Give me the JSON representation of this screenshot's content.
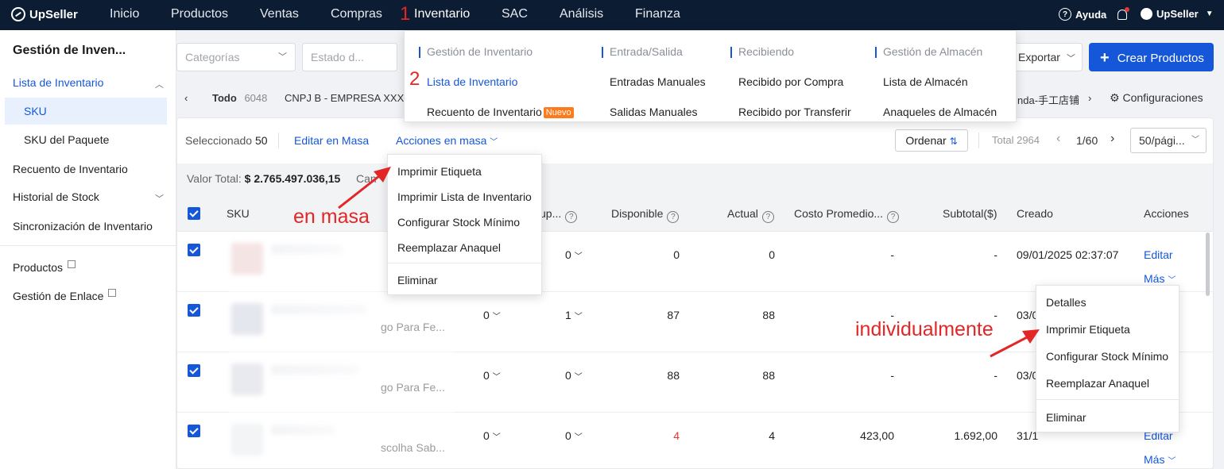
{
  "topnav": {
    "logo": "UpSeller",
    "items": [
      "Inicio",
      "Productos",
      "Ventas",
      "Compras",
      "Inventario",
      "SAC",
      "Análisis",
      "Finanza"
    ],
    "help": "Ayuda",
    "user": "UpSeller"
  },
  "sidebar": {
    "title": "Gestión de Inven...",
    "lista": "Lista de Inventario",
    "sku": "SKU",
    "sku_paquete": "SKU del Paquete",
    "recuento": "Recuento de Inventario",
    "historial": "Historial de Stock",
    "sincronizacion": "Sincronización de Inventario",
    "productos": "Productos",
    "enlace": "Gestión de Enlace"
  },
  "filters": {
    "categorias": "Categorías",
    "estado": "Estado d...",
    "exportar": "Exportar",
    "crear": "Crear Productos"
  },
  "stores": {
    "todo": "Todo",
    "todo_count": "6048",
    "store1": "CNPJ B - EMPRESA XXX",
    "store_last": "nda-手工店铺",
    "config": "Configuraciones"
  },
  "toolbar": {
    "seleccionado": "Seleccionado",
    "seleccionado_count": "50",
    "editar_masa": "Editar en Masa",
    "acciones_masa": "Acciones en masa",
    "ordenar": "Ordenar",
    "total_label": "Total",
    "total": "2964",
    "page": "1/60",
    "perpage": "50/pági..."
  },
  "totalbar": {
    "label": "Valor Total:",
    "value": "$ 2.765.497.036,15",
    "cant": "Can"
  },
  "table": {
    "headers": {
      "sku": "SKU",
      "up": "up...",
      "disponible": "Disponible",
      "actual": "Actual",
      "costo": "Costo Promedio...",
      "subtotal": "Subtotal($)",
      "creado": "Creado",
      "acciones": "Acciones"
    },
    "rows": [
      {
        "name": "",
        "c1": "",
        "c2": "0",
        "disponible": "0",
        "actual": "0",
        "costo": "-",
        "subtotal": "-",
        "creado": "09/01/2025 02:37:07",
        "editar": "Editar",
        "mas": "Más"
      },
      {
        "name": "go Para Fe...",
        "c1": "0",
        "c2": "1",
        "disponible": "87",
        "actual": "88",
        "costo": "-",
        "subtotal": "-",
        "creado": "03/0"
      },
      {
        "name": "go Para Fe...",
        "c1": "0",
        "c2": "0",
        "disponible": "88",
        "actual": "88",
        "costo": "-",
        "subtotal": "-",
        "creado": "03/0"
      },
      {
        "name": "scolha Sab...",
        "c1": "0",
        "c2": "0",
        "disponible": "4",
        "actual": "4",
        "costo": "423,00",
        "subtotal": "1.692,00",
        "creado": "31/1",
        "editar": "Editar",
        "mas": "Más"
      }
    ]
  },
  "mega_menu": {
    "columns": [
      {
        "header": "Gestión de Inventario",
        "items": [
          "Lista de Inventario",
          "Recuento de Inventario"
        ]
      },
      {
        "header": "Entrada/Salida",
        "items": [
          "Entradas Manuales",
          "Salidas Manuales"
        ]
      },
      {
        "header": "Recibiendo",
        "items": [
          "Recibido por Compra",
          "Recibido por Transferir"
        ]
      },
      {
        "header": "Gestión de Almacén",
        "items": [
          "Lista de Almacén",
          "Anaqueles de Almacén"
        ]
      }
    ],
    "badge": "Nuevo"
  },
  "bulk_menu": {
    "items": [
      "Imprimir Etiqueta",
      "Imprimir Lista de Inventario",
      "Configurar Stock Mínimo",
      "Reemplazar Anaquel"
    ],
    "danger": "Eliminar"
  },
  "row_menu": {
    "items": [
      "Detalles",
      "Imprimir Etiqueta",
      "Configurar Stock Mínimo",
      "Reemplazar Anaquel"
    ],
    "danger": "Eliminar"
  },
  "annotations": {
    "step1": "1",
    "step2": "2",
    "masa": "en masa",
    "individual": "individualmente"
  },
  "colors": {
    "nav_bg": "#0c1c33",
    "primary": "#1557d8",
    "annotation": "#e32626",
    "badge": "#ff7a1a"
  }
}
